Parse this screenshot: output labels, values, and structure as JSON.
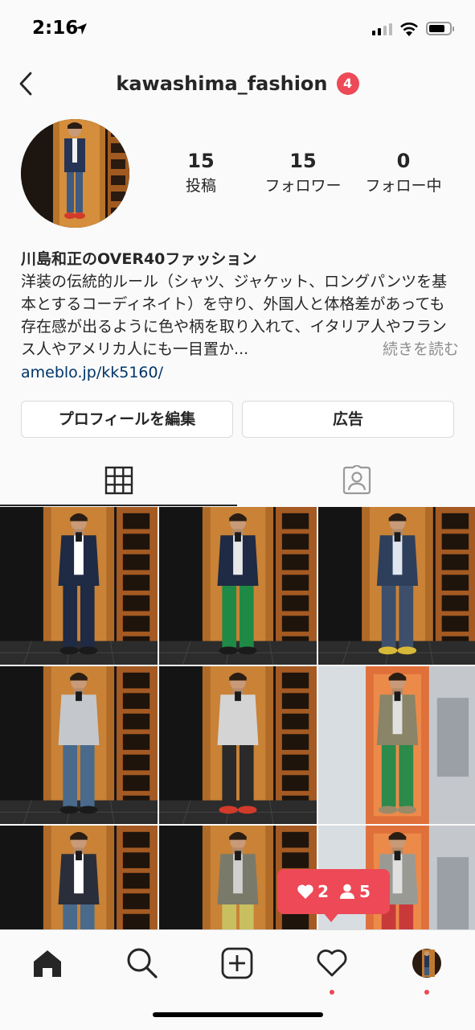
{
  "status_bar": {
    "time": "2:16",
    "battery_level": 0.8
  },
  "header": {
    "username": "kawashima_fashion",
    "notification_count": "4"
  },
  "profile": {
    "stats": [
      {
        "key": "posts",
        "value": "15",
        "label": "投稿"
      },
      {
        "key": "followers",
        "value": "15",
        "label": "フォロワー"
      },
      {
        "key": "following",
        "value": "0",
        "label": "フォロー中"
      }
    ],
    "bio_name": "川島和正のOVER40ファッション",
    "bio_text": "洋装の伝統的ルール（シャツ、ジャケット、ロングパンツを基本とするコーディネイト）を守り、外国人と体格差があっても存在感が出るように色や柄を取り入れて、イタリア人やフランス人やアメリカ人にも一目置か...",
    "bio_more": "続きを読む",
    "bio_link": "ameblo.jp/kk5160/"
  },
  "actions": {
    "edit_profile": "プロフィールを編集",
    "promote": "広告"
  },
  "tabs": [
    {
      "icon": "grid-icon",
      "active": true
    },
    {
      "icon": "tagged-person-icon",
      "active": false
    }
  ],
  "grid_posts": [
    {
      "jacket": "#1f2a44",
      "pants": "#1f2a44",
      "shoes": "#1a1a1a",
      "shirt": "#ffffff",
      "scene": "closet"
    },
    {
      "jacket": "#1f2a44",
      "pants": "#1f8a46",
      "shoes": "#1a1a1a",
      "shirt": "#e8e8e8",
      "scene": "closet"
    },
    {
      "jacket": "#2e3f5c",
      "pants": "#3d4f6b",
      "shoes": "#d8b838",
      "shirt": "#dfe6ef",
      "scene": "closet"
    },
    {
      "jacket": "#c4c8cc",
      "pants": "#4a6a8c",
      "shoes": "#1a1a1a",
      "shirt": "#c4c8cc",
      "scene": "closet"
    },
    {
      "jacket": "#d4d4d4",
      "pants": "#2a2a2a",
      "shoes": "#d23a2a",
      "shirt": "#d4d4d4",
      "scene": "closet"
    },
    {
      "jacket": "#8a8468",
      "pants": "#2c8a4a",
      "shoes": "#9a8a6a",
      "shirt": "#e0e0e0",
      "scene": "elevator"
    },
    {
      "jacket": "#2a2e3a",
      "pants": "#4a6a8c",
      "shoes": "#1a1a1a",
      "shirt": "#ffffff",
      "scene": "closet"
    },
    {
      "jacket": "#7a7a6a",
      "pants": "#c8c060",
      "shoes": "#1a1a1a",
      "shirt": "#d0d0d0",
      "scene": "closet"
    },
    {
      "jacket": "#9a9a94",
      "pants": "#c83a3a",
      "shoes": "#1a1a1a",
      "shirt": "#e0e0e0",
      "scene": "elevator"
    }
  ],
  "activity": {
    "likes": "2",
    "follows": "5"
  },
  "bottom_nav": [
    {
      "name": "home",
      "icon": "home-icon",
      "active": true
    },
    {
      "name": "search",
      "icon": "search-icon",
      "active": false
    },
    {
      "name": "new-post",
      "icon": "plus-square-icon",
      "active": false
    },
    {
      "name": "activity",
      "icon": "heart-icon",
      "active": false,
      "dot": true
    },
    {
      "name": "profile",
      "icon": "avatar",
      "active": false,
      "dot": true
    }
  ],
  "colors": {
    "accent": "#ed4956",
    "link": "#003569",
    "muted": "#8e8e8e",
    "border": "#dbdbdb"
  }
}
